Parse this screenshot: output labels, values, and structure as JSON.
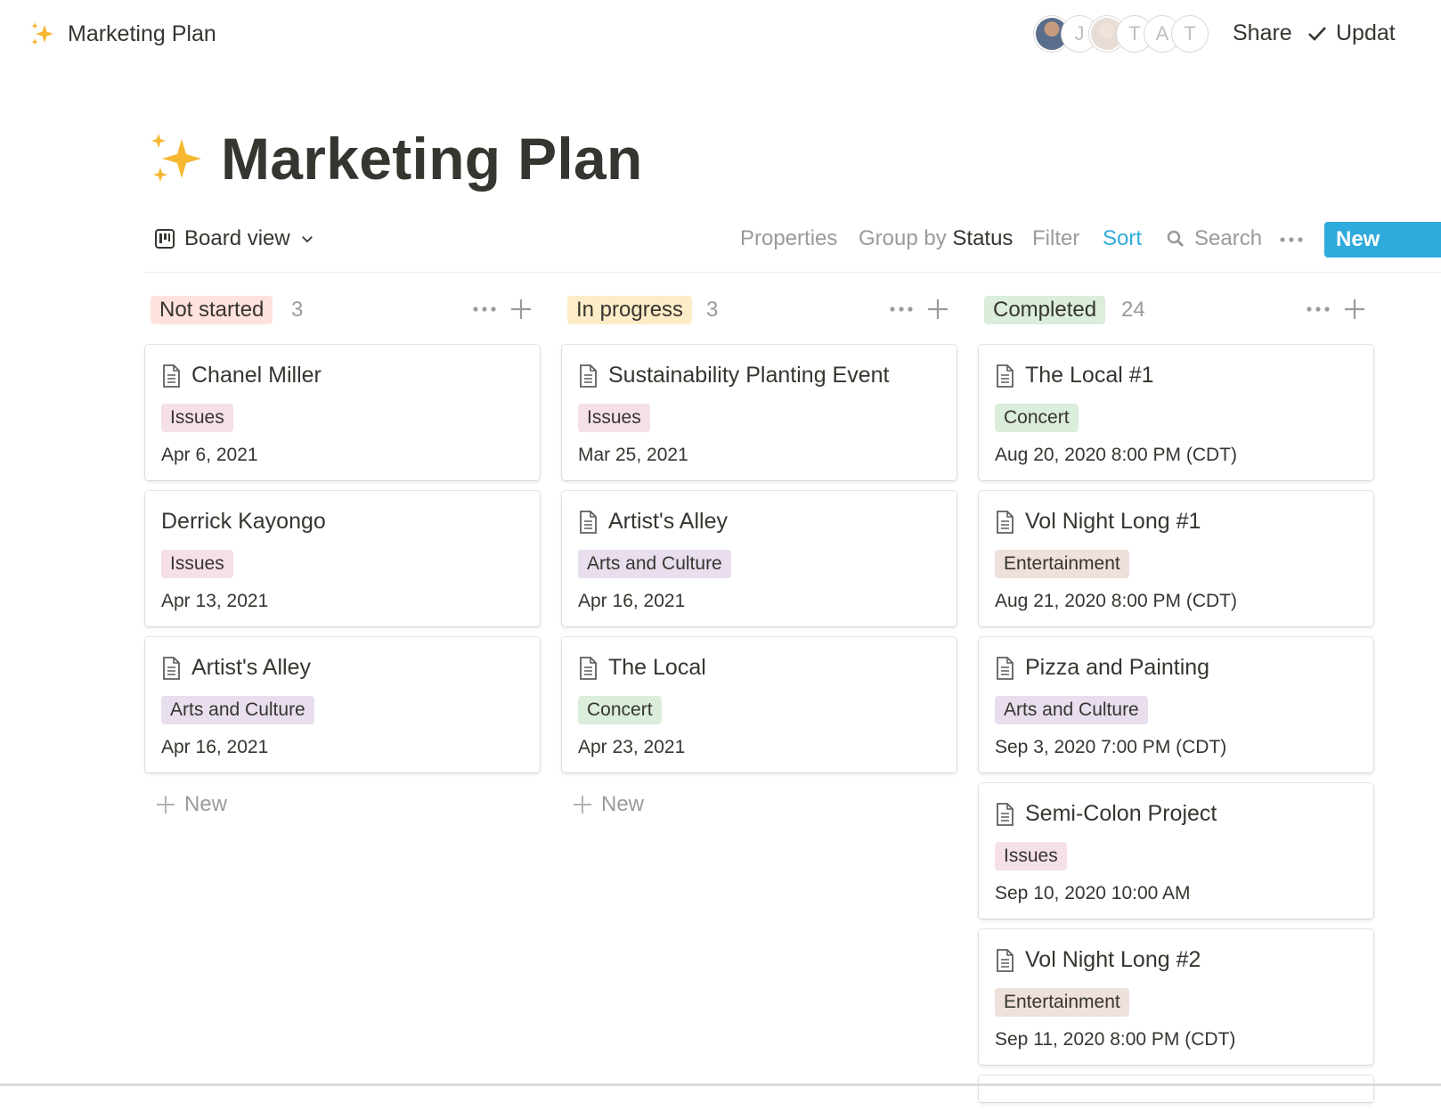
{
  "topbar": {
    "breadcrumb": "Marketing Plan",
    "avatars": [
      {
        "type": "photo",
        "label": ""
      },
      {
        "type": "letter",
        "label": "J"
      },
      {
        "type": "photo",
        "label": ""
      },
      {
        "type": "letter",
        "label": "T"
      },
      {
        "type": "letter",
        "label": "A"
      },
      {
        "type": "letter",
        "label": "T"
      }
    ],
    "share_label": "Share",
    "update_label": "Updat"
  },
  "page": {
    "title": "Marketing Plan",
    "icon": "sparkles-icon"
  },
  "toolbar": {
    "view_label": "Board view",
    "properties_label": "Properties",
    "group_prefix": "Group by",
    "group_value": "Status",
    "filter_label": "Filter",
    "sort_label": "Sort",
    "search_label": "Search",
    "new_label": "New"
  },
  "colors": {
    "accent": "#2eaadc",
    "tag_issues": "#f5e0e9",
    "tag_arts": "#e8deee",
    "tag_concert": "#dbeddb",
    "tag_entertainment": "#eee0da",
    "status_not_started": "#ffe2dd",
    "status_in_progress": "#fdecc8",
    "status_completed": "#dbeddb"
  },
  "board": {
    "add_new_label": "New",
    "columns": [
      {
        "name": "Not started",
        "count": "3",
        "cards": [
          {
            "title": "Chanel Miller",
            "tag": "Issues",
            "date": "Apr 6, 2021",
            "has_icon": true
          },
          {
            "title": "Derrick Kayongo",
            "tag": "Issues",
            "date": "Apr 13, 2021",
            "has_icon": false
          },
          {
            "title": "Artist's Alley",
            "tag": "Arts and Culture",
            "date": "Apr 16, 2021",
            "has_icon": true
          }
        ]
      },
      {
        "name": "In progress",
        "count": "3",
        "cards": [
          {
            "title": "Sustainability Planting Event",
            "tag": "Issues",
            "date": "Mar 25, 2021",
            "has_icon": true
          },
          {
            "title": "Artist's Alley",
            "tag": "Arts and Culture",
            "date": "Apr 16, 2021",
            "has_icon": true
          },
          {
            "title": "The Local",
            "tag": "Concert",
            "date": "Apr 23, 2021",
            "has_icon": true
          }
        ]
      },
      {
        "name": "Completed",
        "count": "24",
        "cards": [
          {
            "title": "The Local #1",
            "tag": "Concert",
            "date": "Aug 20, 2020 8:00 PM (CDT)",
            "has_icon": true
          },
          {
            "title": "Vol Night Long #1",
            "tag": "Entertainment",
            "date": "Aug 21, 2020 8:00 PM (CDT)",
            "has_icon": true
          },
          {
            "title": "Pizza and Painting",
            "tag": "Arts and Culture",
            "date": "Sep 3, 2020 7:00 PM (CDT)",
            "has_icon": true
          },
          {
            "title": "Semi-Colon Project",
            "tag": "Issues",
            "date": "Sep 10, 2020 10:00 AM",
            "has_icon": true
          },
          {
            "title": "Vol Night Long #2",
            "tag": "Entertainment",
            "date": "Sep 11, 2020 8:00 PM (CDT)",
            "has_icon": true
          }
        ]
      }
    ]
  }
}
